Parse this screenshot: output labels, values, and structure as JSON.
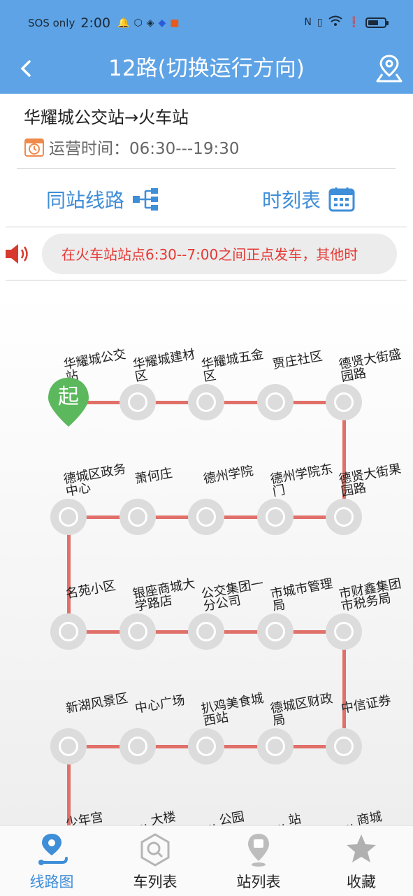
{
  "status_bar": {
    "carrier": "SOS only",
    "time": "2:00",
    "icons_left": [
      "bell-icon",
      "cube-icon",
      "shield-icon",
      "bird-app-icon",
      "running-app-icon"
    ],
    "icons_right": [
      "nfc-icon",
      "vibrate-icon",
      "wifi-icon",
      "alert-icon",
      "battery-icon"
    ]
  },
  "header": {
    "title": "12路(切换运行方向)",
    "back_icon": "chevron-left-icon",
    "map_icon": "map-pin-icon"
  },
  "route": {
    "direction": "华耀城公交站→火车站",
    "op_time": "运营时间：06:30---19:30"
  },
  "links": {
    "same_stop_lines": "同站线路",
    "timetable": "时刻表"
  },
  "notice": {
    "text": "在火车站站点6:30--7:00之间正点发车，其他时"
  },
  "route_map": {
    "start_label": "起",
    "line_color": "#e07069",
    "rows": [
      [
        "华耀城公交站",
        "华耀城建材区",
        "华耀城五金区",
        "贾庄社区",
        "德贤大街盛园路"
      ],
      [
        "德城区政务中心",
        "萧何庄",
        "德州学院",
        "德州学院东门",
        "德贤大街果园路"
      ],
      [
        "名苑小区",
        "银座商城大学路店",
        "公交集团一分公司",
        "市城市管理局",
        "市财鑫集团市税务局"
      ],
      [
        "新湖风景区",
        "中心广场",
        "扒鸡美食城西站",
        "德城区财政局",
        "中信证券"
      ],
      [
        "少年宫",
        "... 大楼",
        "... 公园",
        "... 站",
        "... 商城"
      ]
    ]
  },
  "bottom_nav": {
    "items": [
      {
        "label": "线路图",
        "icon": "route-icon",
        "active": true
      },
      {
        "label": "车列表",
        "icon": "search-hex-icon",
        "active": false
      },
      {
        "label": "站列表",
        "icon": "bus-stop-icon",
        "active": false
      },
      {
        "label": "收藏",
        "icon": "star-icon",
        "active": false
      }
    ],
    "accent": "#3f8ed8"
  },
  "colors": {
    "header_bg": "#5ea3e5",
    "notice_text": "#e53935",
    "start_pin": "#5cb85c"
  }
}
